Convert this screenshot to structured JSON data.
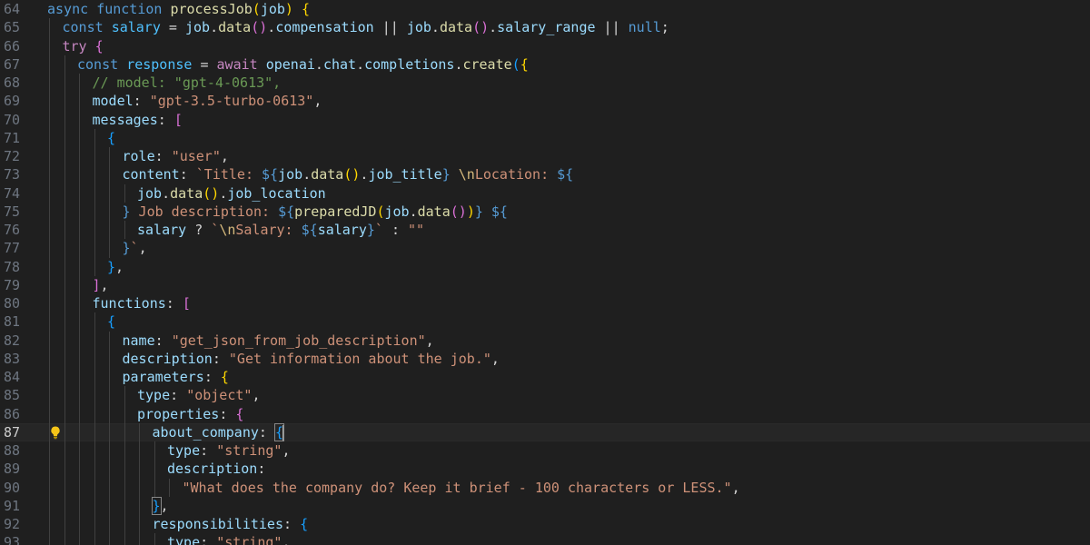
{
  "editor": {
    "active_line": 87,
    "lightbulb_icon": "lightbulb-icon",
    "lines": [
      {
        "n": 64,
        "indent": 0,
        "tokens": [
          [
            "kw",
            "async"
          ],
          [
            "op",
            " "
          ],
          [
            "kw",
            "function"
          ],
          [
            "op",
            " "
          ],
          [
            "fn",
            "processJob"
          ],
          [
            "b1",
            "("
          ],
          [
            "var",
            "job"
          ],
          [
            "b1",
            ")"
          ],
          [
            "op",
            " "
          ],
          [
            "b1",
            "{"
          ]
        ]
      },
      {
        "n": 65,
        "indent": 1,
        "tokens": [
          [
            "kw",
            "const"
          ],
          [
            "op",
            " "
          ],
          [
            "const",
            "salary"
          ],
          [
            "op",
            " = "
          ],
          [
            "var",
            "job"
          ],
          [
            "pun",
            "."
          ],
          [
            "fn",
            "data"
          ],
          [
            "b2",
            "()"
          ],
          [
            "pun",
            "."
          ],
          [
            "var",
            "compensation"
          ],
          [
            "op",
            " || "
          ],
          [
            "var",
            "job"
          ],
          [
            "pun",
            "."
          ],
          [
            "fn",
            "data"
          ],
          [
            "b2",
            "()"
          ],
          [
            "pun",
            "."
          ],
          [
            "var",
            "salary_range"
          ],
          [
            "op",
            " || "
          ],
          [
            "kw",
            "null"
          ],
          [
            "pun",
            ";"
          ]
        ]
      },
      {
        "n": 66,
        "indent": 1,
        "tokens": [
          [
            "ctl",
            "try"
          ],
          [
            "op",
            " "
          ],
          [
            "b2",
            "{"
          ]
        ]
      },
      {
        "n": 67,
        "indent": 2,
        "tokens": [
          [
            "kw",
            "const"
          ],
          [
            "op",
            " "
          ],
          [
            "const",
            "response"
          ],
          [
            "op",
            " = "
          ],
          [
            "ctl",
            "await"
          ],
          [
            "op",
            " "
          ],
          [
            "var",
            "openai"
          ],
          [
            "pun",
            "."
          ],
          [
            "var",
            "chat"
          ],
          [
            "pun",
            "."
          ],
          [
            "var",
            "completions"
          ],
          [
            "pun",
            "."
          ],
          [
            "fn",
            "create"
          ],
          [
            "b3",
            "("
          ],
          [
            "b1",
            "{"
          ]
        ]
      },
      {
        "n": 68,
        "indent": 3,
        "tokens": [
          [
            "cmt",
            "// model: \"gpt-4-0613\","
          ]
        ]
      },
      {
        "n": 69,
        "indent": 3,
        "tokens": [
          [
            "var",
            "model"
          ],
          [
            "pun",
            ": "
          ],
          [
            "str",
            "\"gpt-3.5-turbo-0613\""
          ],
          [
            "pun",
            ","
          ]
        ]
      },
      {
        "n": 70,
        "indent": 3,
        "tokens": [
          [
            "var",
            "messages"
          ],
          [
            "pun",
            ": "
          ],
          [
            "b2",
            "["
          ]
        ]
      },
      {
        "n": 71,
        "indent": 4,
        "tokens": [
          [
            "b3",
            "{"
          ]
        ]
      },
      {
        "n": 72,
        "indent": 5,
        "tokens": [
          [
            "var",
            "role"
          ],
          [
            "pun",
            ": "
          ],
          [
            "str",
            "\"user\""
          ],
          [
            "pun",
            ","
          ]
        ]
      },
      {
        "n": 73,
        "indent": 5,
        "tokens": [
          [
            "var",
            "content"
          ],
          [
            "pun",
            ": "
          ],
          [
            "str",
            "`Title: "
          ],
          [
            "kw",
            "${"
          ],
          [
            "var",
            "job"
          ],
          [
            "pun",
            "."
          ],
          [
            "fn",
            "data"
          ],
          [
            "b1",
            "()"
          ],
          [
            "pun",
            "."
          ],
          [
            "var",
            "job_title"
          ],
          [
            "kw",
            "}"
          ],
          [
            "str",
            " "
          ],
          [
            "esc",
            "\\n"
          ],
          [
            "str",
            "Location: "
          ],
          [
            "kw",
            "${"
          ]
        ]
      },
      {
        "n": 74,
        "indent": 6,
        "tokens": [
          [
            "var",
            "job"
          ],
          [
            "pun",
            "."
          ],
          [
            "fn",
            "data"
          ],
          [
            "b1",
            "()"
          ],
          [
            "pun",
            "."
          ],
          [
            "var",
            "job_location"
          ]
        ]
      },
      {
        "n": 75,
        "indent": 5,
        "tokens": [
          [
            "kw",
            "}"
          ],
          [
            "str",
            " Job description: "
          ],
          [
            "kw",
            "${"
          ],
          [
            "fn",
            "preparedJD"
          ],
          [
            "b1",
            "("
          ],
          [
            "var",
            "job"
          ],
          [
            "pun",
            "."
          ],
          [
            "fn",
            "data"
          ],
          [
            "b2",
            "()"
          ],
          [
            "b1",
            ")"
          ],
          [
            "kw",
            "}"
          ],
          [
            "str",
            " "
          ],
          [
            "kw",
            "${"
          ]
        ]
      },
      {
        "n": 76,
        "indent": 6,
        "tokens": [
          [
            "var",
            "salary"
          ],
          [
            "op",
            " ? "
          ],
          [
            "str",
            "`"
          ],
          [
            "esc",
            "\\n"
          ],
          [
            "str",
            "Salary: "
          ],
          [
            "kw",
            "${"
          ],
          [
            "var",
            "salary"
          ],
          [
            "kw",
            "}"
          ],
          [
            "str",
            "`"
          ],
          [
            "op",
            " : "
          ],
          [
            "str",
            "\"\""
          ]
        ]
      },
      {
        "n": 77,
        "indent": 5,
        "tokens": [
          [
            "kw",
            "}"
          ],
          [
            "str",
            "`"
          ],
          [
            "pun",
            ","
          ]
        ]
      },
      {
        "n": 78,
        "indent": 4,
        "tokens": [
          [
            "b3",
            "}"
          ],
          [
            "pun",
            ","
          ]
        ]
      },
      {
        "n": 79,
        "indent": 3,
        "tokens": [
          [
            "b2",
            "]"
          ],
          [
            "pun",
            ","
          ]
        ]
      },
      {
        "n": 80,
        "indent": 3,
        "tokens": [
          [
            "var",
            "functions"
          ],
          [
            "pun",
            ": "
          ],
          [
            "b2",
            "["
          ]
        ]
      },
      {
        "n": 81,
        "indent": 4,
        "tokens": [
          [
            "b3",
            "{"
          ]
        ]
      },
      {
        "n": 82,
        "indent": 5,
        "tokens": [
          [
            "var",
            "name"
          ],
          [
            "pun",
            ": "
          ],
          [
            "str",
            "\"get_json_from_job_description\""
          ],
          [
            "pun",
            ","
          ]
        ]
      },
      {
        "n": 83,
        "indent": 5,
        "tokens": [
          [
            "var",
            "description"
          ],
          [
            "pun",
            ": "
          ],
          [
            "str",
            "\"Get information about the job.\""
          ],
          [
            "pun",
            ","
          ]
        ]
      },
      {
        "n": 84,
        "indent": 5,
        "tokens": [
          [
            "var",
            "parameters"
          ],
          [
            "pun",
            ": "
          ],
          [
            "b1",
            "{"
          ]
        ]
      },
      {
        "n": 85,
        "indent": 6,
        "tokens": [
          [
            "var",
            "type"
          ],
          [
            "pun",
            ": "
          ],
          [
            "str",
            "\"object\""
          ],
          [
            "pun",
            ","
          ]
        ]
      },
      {
        "n": 86,
        "indent": 6,
        "tokens": [
          [
            "var",
            "properties"
          ],
          [
            "pun",
            ": "
          ],
          [
            "b2",
            "{"
          ]
        ]
      },
      {
        "n": 87,
        "indent": 7,
        "tokens": [
          [
            "var",
            "about_company"
          ],
          [
            "pun",
            ": "
          ],
          [
            "b3bm",
            "{"
          ]
        ]
      },
      {
        "n": 88,
        "indent": 8,
        "tokens": [
          [
            "var",
            "type"
          ],
          [
            "pun",
            ": "
          ],
          [
            "str",
            "\"string\""
          ],
          [
            "pun",
            ","
          ]
        ]
      },
      {
        "n": 89,
        "indent": 8,
        "tokens": [
          [
            "var",
            "description"
          ],
          [
            "pun",
            ":"
          ]
        ]
      },
      {
        "n": 90,
        "indent": 9,
        "tokens": [
          [
            "str",
            "\"What does the company do? Keep it brief - 100 characters or LESS.\""
          ],
          [
            "pun",
            ","
          ]
        ]
      },
      {
        "n": 91,
        "indent": 7,
        "tokens": [
          [
            "b3bm",
            "}"
          ],
          [
            "pun",
            ","
          ]
        ]
      },
      {
        "n": 92,
        "indent": 7,
        "tokens": [
          [
            "var",
            "responsibilities"
          ],
          [
            "pun",
            ": "
          ],
          [
            "b3",
            "{"
          ]
        ]
      },
      {
        "n": 93,
        "indent": 8,
        "tokens": [
          [
            "var",
            "type"
          ],
          [
            "pun",
            ": "
          ],
          [
            "str",
            "\"string\""
          ],
          [
            "pun",
            ","
          ]
        ]
      }
    ]
  }
}
